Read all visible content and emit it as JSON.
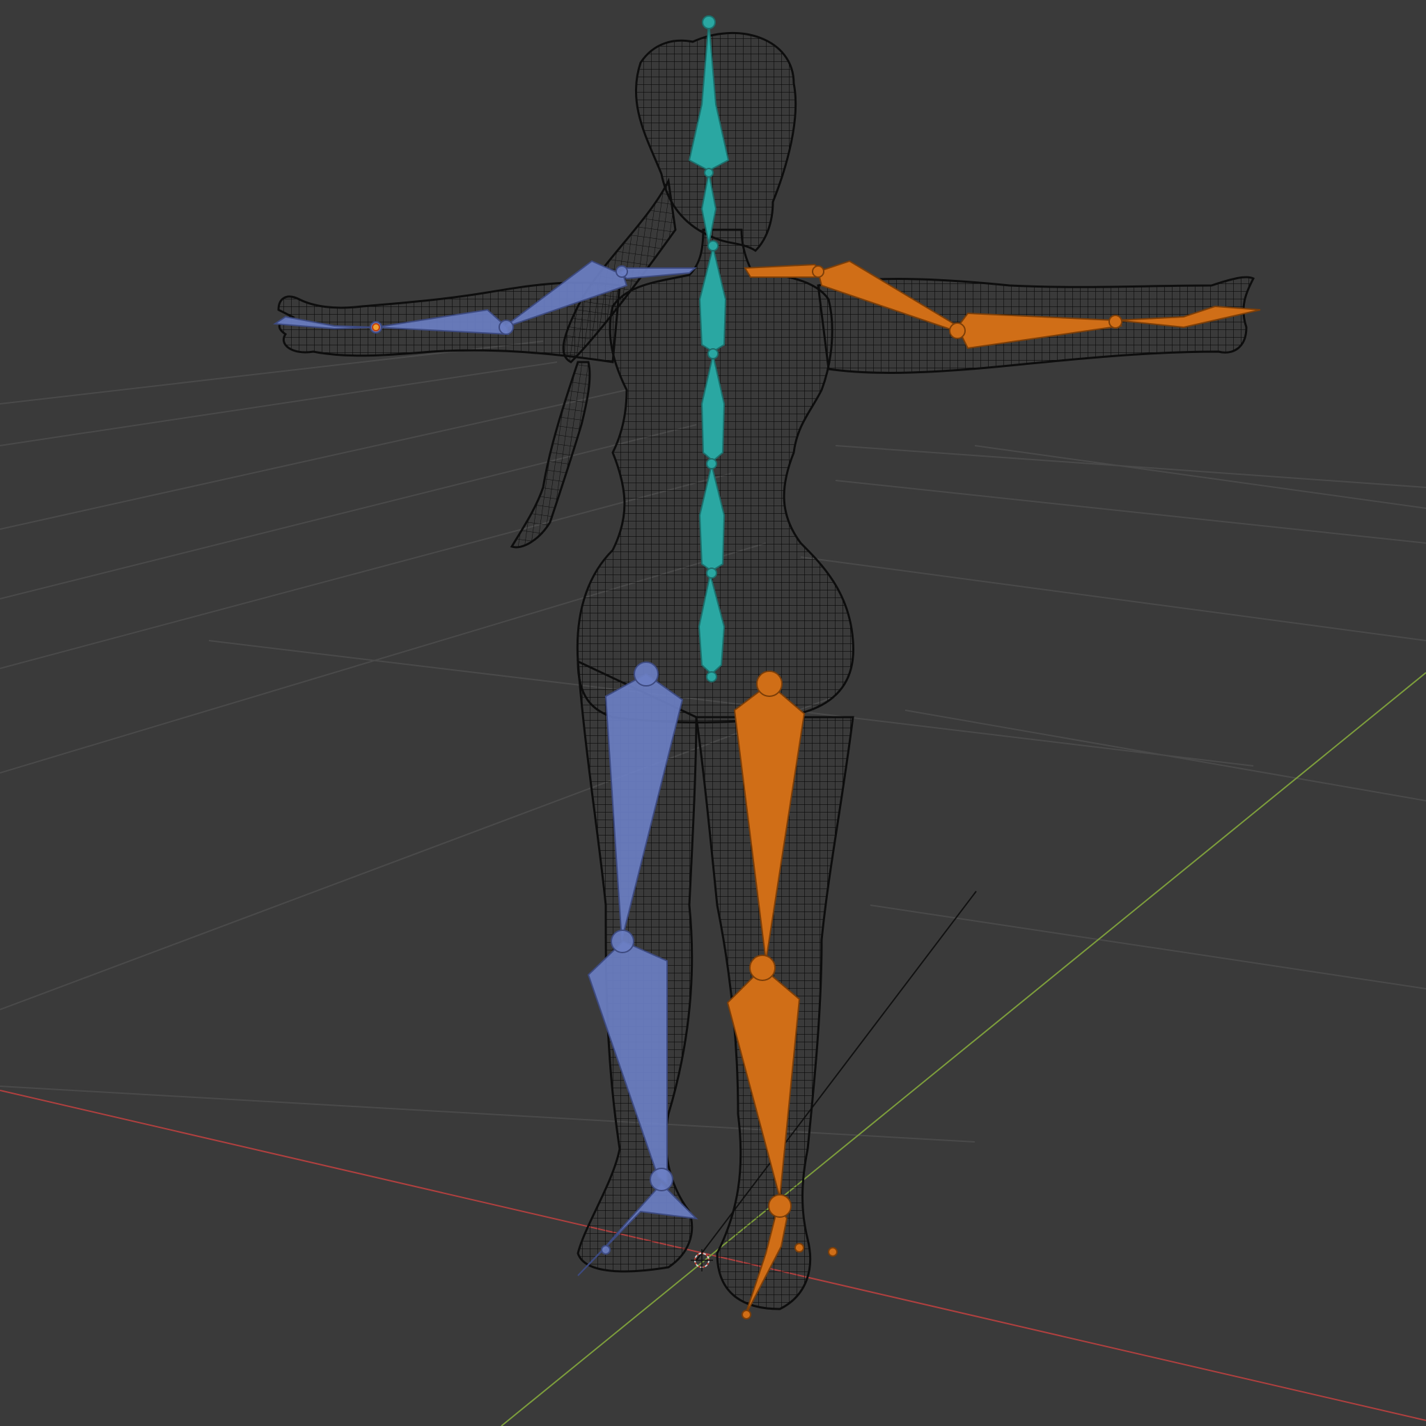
{
  "viewport": {
    "background": "#3a3a3a",
    "grid_color": "#4a4a4a",
    "x_axis_color": "#b0403f",
    "y_axis_color": "#7d9e3c",
    "wireframe_color": "#0d0d0d",
    "mesh_fill": "#2c2c2c"
  },
  "armature": {
    "spine_color": "#2aa7a2",
    "left_side_color": "#6b7fc3",
    "right_side_color": "#d06e17"
  },
  "icons": {
    "cursor": "3d-cursor-icon",
    "origin": "object-origin-icon"
  }
}
